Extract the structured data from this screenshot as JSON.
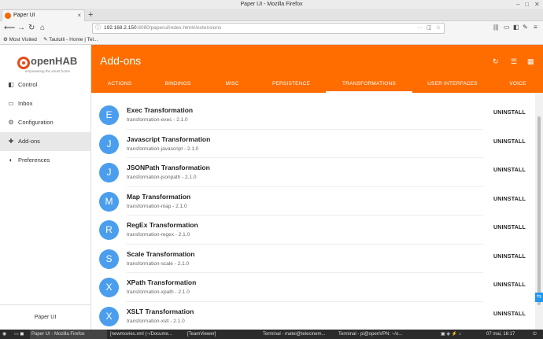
{
  "window": {
    "title": "Paper UI - Mozilla Firefox"
  },
  "browser": {
    "tab_title": "Paper UI",
    "url_host": "192.168.2.150",
    "url_rest": ":8080/paperui/index.html#/extensions",
    "bookmarks": [
      "Most Visited",
      "Tautulli - Home | Tel..."
    ]
  },
  "sidebar": {
    "logo_text": "openHAB",
    "logo_tagline": "empowering the smart home",
    "items": [
      {
        "label": "Control",
        "icon": "sliders-icon"
      },
      {
        "label": "Inbox",
        "icon": "inbox-icon"
      },
      {
        "label": "Configuration",
        "icon": "gear-icon"
      },
      {
        "label": "Add-ons",
        "icon": "puzzle-icon"
      },
      {
        "label": "Preferences",
        "icon": "contrast-icon"
      }
    ],
    "footer": "Paper UI"
  },
  "header": {
    "title": "Add-ons",
    "tabs": [
      "ACTIONS",
      "BINDINGS",
      "MISC",
      "PERSISTENCE",
      "TRANSFORMATIONS",
      "USER INTERFACES",
      "VOICE"
    ],
    "selected_tab": "TRANSFORMATIONS",
    "accent_color": "#ff6d00"
  },
  "addons": [
    {
      "letter": "E",
      "name": "Exec Transformation",
      "id": "transformation-exec - 2.1.0",
      "action": "UNINSTALL"
    },
    {
      "letter": "J",
      "name": "Javascript Transformation",
      "id": "transformation-javascript - 2.1.0",
      "action": "UNINSTALL"
    },
    {
      "letter": "J",
      "name": "JSONPath Transformation",
      "id": "transformation-jsonpath - 2.1.0",
      "action": "UNINSTALL"
    },
    {
      "letter": "M",
      "name": "Map Transformation",
      "id": "transformation-map - 2.1.0",
      "action": "UNINSTALL"
    },
    {
      "letter": "R",
      "name": "RegEx Transformation",
      "id": "transformation-regex - 2.1.0",
      "action": "UNINSTALL"
    },
    {
      "letter": "S",
      "name": "Scale Transformation",
      "id": "transformation-scale - 2.1.0",
      "action": "UNINSTALL"
    },
    {
      "letter": "X",
      "name": "XPath Transformation",
      "id": "transformation-xpath - 2.1.0",
      "action": "UNINSTALL"
    },
    {
      "letter": "X",
      "name": "XSLT Transformation",
      "id": "transformation-xslt - 2.1.0",
      "action": "UNINSTALL"
    }
  ],
  "taskbar": {
    "items": [
      "Paper UI - Mozilla Firefox",
      "[newmovies.xml (~/Docume...",
      "[TeamViewer]",
      "Terminal - matei@telecinem...",
      "Terminal - pi@openVPN: ~/o..."
    ],
    "clock": "07 mai, 16:17"
  }
}
